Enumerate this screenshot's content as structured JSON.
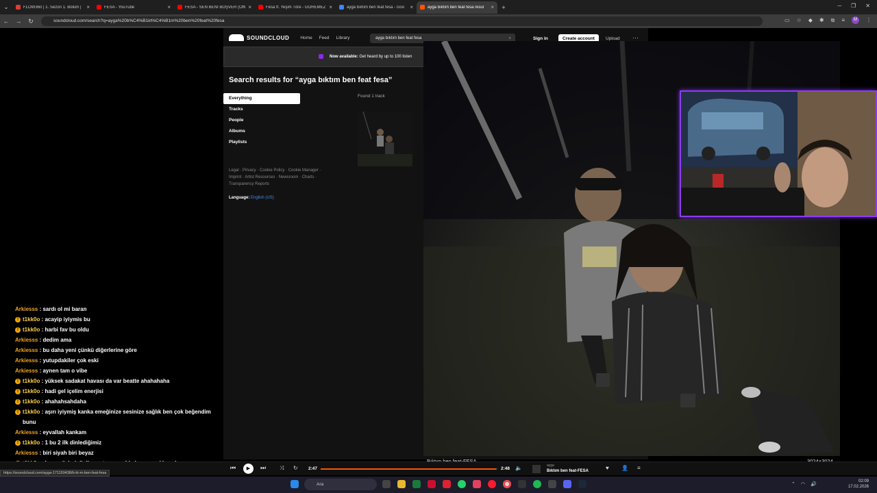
{
  "browser": {
    "tabs": [
      {
        "title": "FLOW360 | 1. Sezon 1. Bölüm |",
        "color": "#e23a3a"
      },
      {
        "title": "FESA - YouTube",
        "color": "#ff0000"
      },
      {
        "title": "FESA - SEN BENİ BOŞVER (Offi",
        "color": "#ff0000"
      },
      {
        "title": "Fesa ft. Yeşim Töre - GÖREMEZ",
        "color": "#ff0000"
      },
      {
        "title": "ayga bıktım ben feat fesa - Goo",
        "color": "#4285f4"
      },
      {
        "title": "ayga bıktım ben feat fesa resul",
        "color": "#ff5500"
      }
    ],
    "url": "soundcloud.com/search?q=ayga%20b%C4%B1kt%C4%B1m%20ben%20feat%20fesa",
    "profile_initial": "M"
  },
  "soundcloud": {
    "logo": "SOUNDCLOUD",
    "nav": [
      "Home",
      "Feed",
      "Library"
    ],
    "search_value": "ayga bıktım ben feat fesa",
    "sign_in": "Sign in",
    "create_account": "Create account",
    "upload": "Upload",
    "more": "···",
    "banner_bold": "Now available:",
    "banner_text": "Get heard by up to 100 listen",
    "results_title": "Search results for “ayga bıktım ben feat fesa”",
    "filters": [
      "Everything",
      "Tracks",
      "People",
      "Albums",
      "Playlists"
    ],
    "found": "Found 1 track",
    "footer_line1": "Legal · Privacy · Cookie Policy · Cookie Manager ·",
    "footer_line2": "Imprint · Artist Resources · Newsroom · Charts ·",
    "footer_line3": "Transparency Reports",
    "language_label": "Language:",
    "language_value": "English (US)"
  },
  "photo": {
    "caption": "Bıktım ben feat-FESA",
    "size": "3024×3024"
  },
  "chat": [
    {
      "user": "Arkiesss",
      "text": "sardı ol mi baran",
      "badge": false
    },
    {
      "user": "t1kk0o",
      "text": "acayip iyiymis bu",
      "badge": true
    },
    {
      "user": "t1kk0o",
      "text": "harbi fav bu oldu",
      "badge": true
    },
    {
      "user": "Arkiesss",
      "text": "dedim ama",
      "badge": false
    },
    {
      "user": "Arkiesss",
      "text": "bu daha yeni çünkü diğerlerine göre",
      "badge": false
    },
    {
      "user": "Arkiesss",
      "text": "yutupdakiler çok eski",
      "badge": false
    },
    {
      "user": "Arkiesss",
      "text": "aynen tam o vibe",
      "badge": false
    },
    {
      "user": "t1kk0o",
      "text": "yüksek sadakat havası da var beatte ahahahaha",
      "badge": true
    },
    {
      "user": "t1kk0o",
      "text": "hadi gel içelim enerjisi",
      "badge": true
    },
    {
      "user": "t1kk0o",
      "text": "ahahahsahdaha",
      "badge": true
    },
    {
      "user": "t1kk0o",
      "text": "aşırı iyiymiş kanka emeğinize sesinize sağlık ben çok beğendim bunu",
      "badge": true
    },
    {
      "user": "Arkiesss",
      "text": "eyvallah kankam",
      "badge": false
    },
    {
      "user": "t1kk0o",
      "text": "1 bu 2 ilk dinlediğimiz",
      "badge": true
    },
    {
      "user": "Arkiesss",
      "text": "biri siyah biri beyaz",
      "badge": false
    },
    {
      "user": "t1kk0o",
      "text": "hazo sözleri dinliyo zaten genelde ben mood kovalıorm",
      "badge": true
    }
  ],
  "player": {
    "elapsed": "2:47",
    "duration": "2:48",
    "progress": 0.994,
    "artist": "ayga",
    "track": "Bıktım ben feat-FESA"
  },
  "status_url": "https://soundcloud.com/ayga-171159438/b-kt-m-ben-feat-fesa",
  "taskbar": {
    "search_placeholder": "Ara",
    "time": "02:09",
    "date": "17.02.2026"
  }
}
